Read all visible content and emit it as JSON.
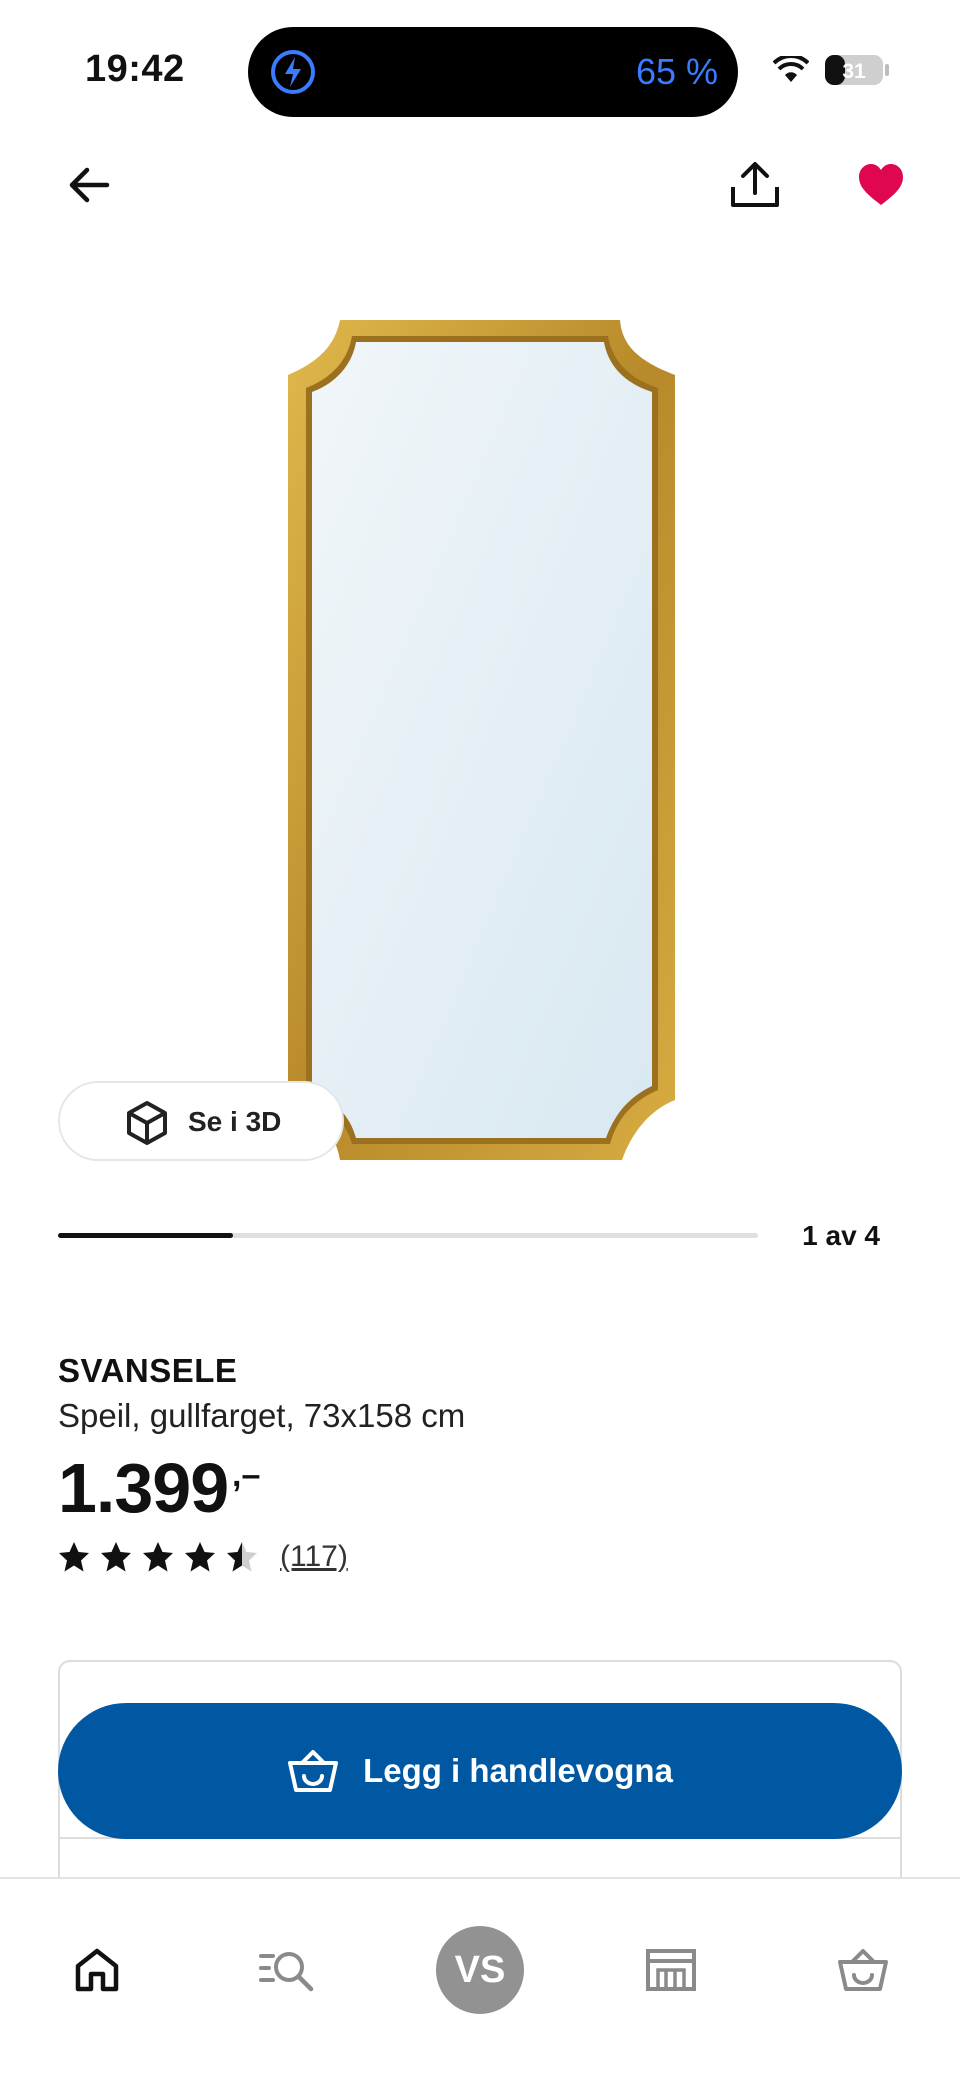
{
  "status_bar": {
    "time": "19:42",
    "battery_percent_text": "65 %",
    "battery_level": "31",
    "accent_color": "#3a7bff"
  },
  "header": {
    "back_icon": "arrow-left-icon",
    "share_icon": "share-icon",
    "favorite_icon": "heart-icon",
    "favorite_color": "#e00751"
  },
  "gallery": {
    "view_3d_label": "Se i 3D",
    "counter": "1 av 4",
    "current_index": 1,
    "total": 4,
    "frame_color": "#c9a036"
  },
  "product": {
    "name": "SVANSELE",
    "description": "Speil, gullfarget, 73x158 cm",
    "price": "1.399",
    "price_suffix": ",–",
    "rating": 4.5,
    "review_count": "(117)"
  },
  "actions": {
    "add_to_cart_label": "Legg i handlevogna",
    "button_color": "#0058a3"
  },
  "bottom_nav": {
    "items": [
      {
        "icon": "home-icon",
        "active": true
      },
      {
        "icon": "search-icon",
        "active": false
      },
      {
        "label": "VS",
        "icon": "avatar",
        "active": false
      },
      {
        "icon": "store-icon",
        "active": false
      },
      {
        "icon": "cart-icon",
        "active": false
      }
    ]
  }
}
